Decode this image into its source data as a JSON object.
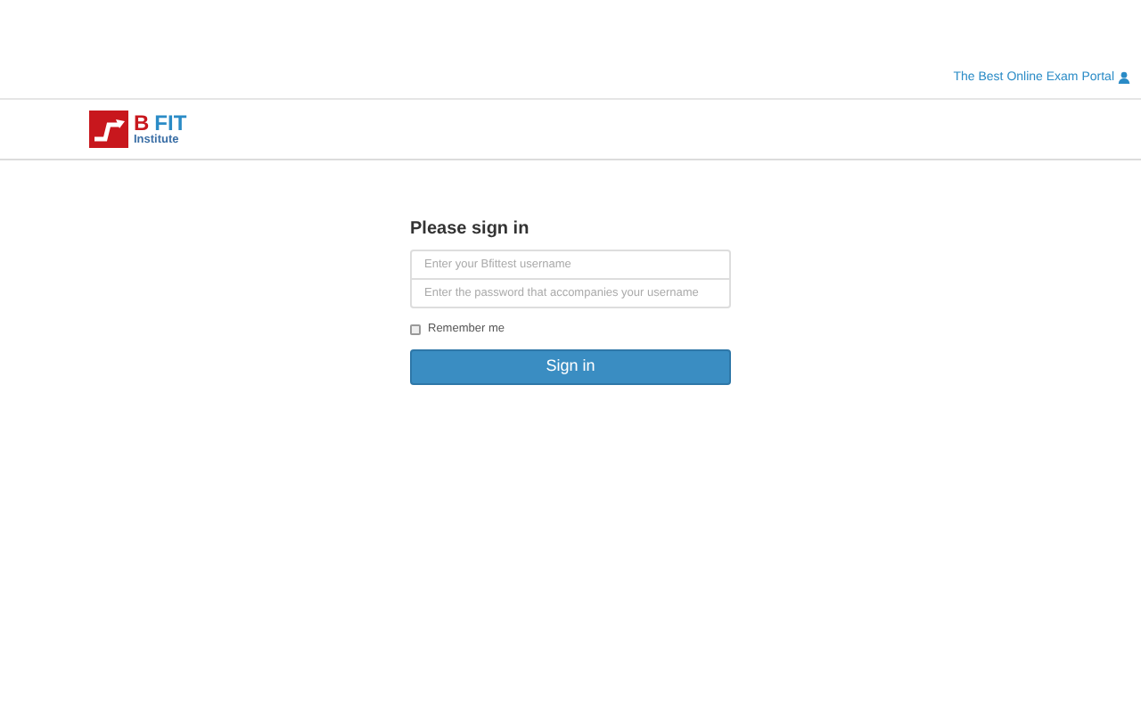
{
  "top_link": {
    "label": "The Best Online Exam Portal"
  },
  "logo": {
    "letter": "B",
    "word": "FIT",
    "subtitle": "Institute"
  },
  "form": {
    "title": "Please sign in",
    "fields": [
      {
        "placeholder": "Enter your Bfittest username"
      },
      {
        "placeholder": "Enter the password that accompanies your username"
      }
    ],
    "remember": {
      "label": "Remember me",
      "checked": false
    },
    "button": "Sign in"
  }
}
